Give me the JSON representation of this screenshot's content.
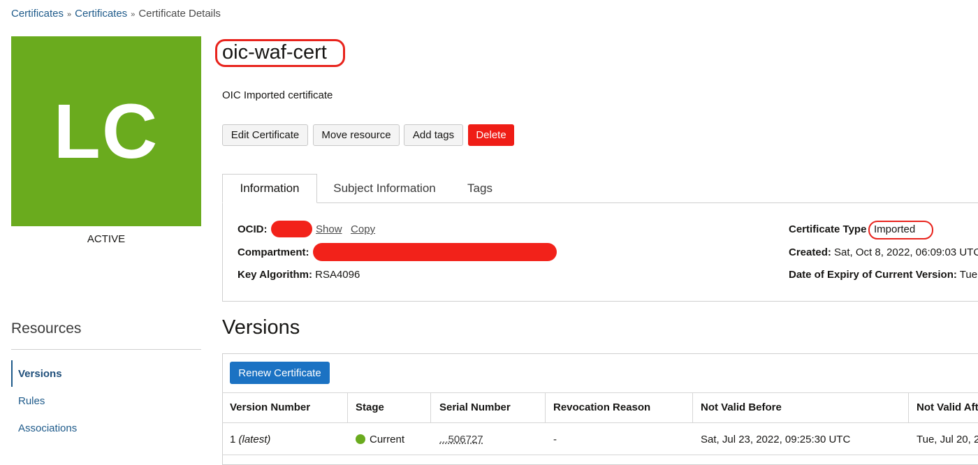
{
  "breadcrumb": {
    "items": [
      "Certificates",
      "Certificates",
      "Certificate Details"
    ]
  },
  "avatar": {
    "initials": "LC",
    "color": "#6aab1e"
  },
  "status": "ACTIVE",
  "title": "oic-waf-cert",
  "description": "OIC Imported certificate",
  "actions": {
    "edit": "Edit Certificate",
    "move": "Move resource",
    "tags": "Add tags",
    "delete": "Delete"
  },
  "tabs": [
    "Information",
    "Subject Information",
    "Tags"
  ],
  "info": {
    "ocid_label": "OCID:",
    "show": "Show",
    "copy": "Copy",
    "compartment_label": "Compartment:",
    "key_algorithm_label": "Key Algorithm:",
    "key_algorithm_value": "RSA4096",
    "cert_type_label": "Certificate Type",
    "cert_type_value": "Imported",
    "created_label": "Created:",
    "created_value": "Sat, Oct 8, 2022, 06:09:03 UTC",
    "expiry_label": "Date of Expiry of Current Version:",
    "expiry_value": "Tue,"
  },
  "resources": {
    "title": "Resources",
    "items": [
      "Versions",
      "Rules",
      "Associations"
    ]
  },
  "versions": {
    "title": "Versions",
    "renew_label": "Renew Certificate",
    "columns": [
      "Version Number",
      "Stage",
      "Serial Number",
      "Revocation Reason",
      "Not Valid Before",
      "Not Valid Aft"
    ],
    "rows": [
      {
        "version": "1",
        "latest": "(latest)",
        "stage": "Current",
        "serial": "...506727",
        "revocation": "-",
        "not_valid_before": "Sat, Jul 23, 2022, 09:25:30 UTC",
        "not_valid_after": "Tue, Jul 20, 2"
      }
    ]
  },
  "colors": {
    "accent": "#1b72c3",
    "danger": "#ef1d16",
    "status_active": "#6aab1e",
    "annotation": "#e8231c",
    "redaction": "#f2221a"
  }
}
